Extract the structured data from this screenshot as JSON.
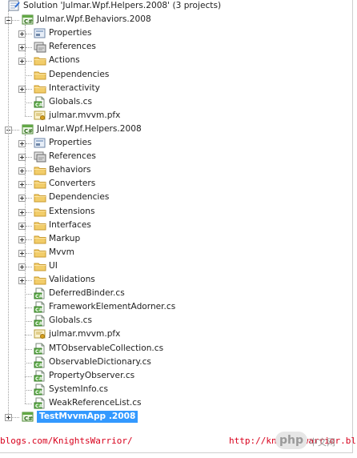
{
  "solution_explorer": {
    "solution": {
      "label": "Solution 'Julmar.Wpf.Helpers.2008' (3 projects)",
      "icon": "solution-icon"
    },
    "projects": [
      {
        "label": "Julmar.Wpf.Behaviors.2008",
        "icon": "csharp-project-icon",
        "expanded": true,
        "items": [
          {
            "label": "Properties",
            "icon": "properties-icon",
            "expandable": true
          },
          {
            "label": "References",
            "icon": "references-icon",
            "expandable": true
          },
          {
            "label": "Actions",
            "icon": "folder-icon",
            "expandable": true
          },
          {
            "label": "Dependencies",
            "icon": "folder-icon",
            "expandable": false
          },
          {
            "label": "Interactivity",
            "icon": "folder-icon",
            "expandable": true
          },
          {
            "label": "Globals.cs",
            "icon": "cs-file-icon",
            "expandable": false
          },
          {
            "label": "julmar.mvvm.pfx",
            "icon": "certificate-icon",
            "expandable": false
          }
        ]
      },
      {
        "label": "Julmar.Wpf.Helpers.2008",
        "icon": "csharp-project-icon",
        "expanded": true,
        "items": [
          {
            "label": "Properties",
            "icon": "properties-icon",
            "expandable": true
          },
          {
            "label": "References",
            "icon": "references-icon",
            "expandable": true
          },
          {
            "label": "Behaviors",
            "icon": "folder-icon",
            "expandable": true
          },
          {
            "label": "Converters",
            "icon": "folder-icon",
            "expandable": true
          },
          {
            "label": "Dependencies",
            "icon": "folder-icon",
            "expandable": true
          },
          {
            "label": "Extensions",
            "icon": "folder-icon",
            "expandable": true
          },
          {
            "label": "Interfaces",
            "icon": "folder-icon",
            "expandable": true
          },
          {
            "label": "Markup",
            "icon": "folder-icon",
            "expandable": true
          },
          {
            "label": "Mvvm",
            "icon": "folder-icon",
            "expandable": true
          },
          {
            "label": "UI",
            "icon": "folder-icon",
            "expandable": true
          },
          {
            "label": "Validations",
            "icon": "folder-icon",
            "expandable": true
          },
          {
            "label": "DeferredBinder.cs",
            "icon": "cs-file-icon",
            "expandable": false
          },
          {
            "label": "FrameworkElementAdorner.cs",
            "icon": "cs-file-icon",
            "expandable": false
          },
          {
            "label": "Globals.cs",
            "icon": "cs-file-icon",
            "expandable": false
          },
          {
            "label": "julmar.mvvm.pfx",
            "icon": "certificate-icon",
            "expandable": false
          },
          {
            "label": "MTObservableCollection.cs",
            "icon": "cs-file-icon",
            "expandable": false
          },
          {
            "label": "ObservableDictionary.cs",
            "icon": "cs-file-icon",
            "expandable": false
          },
          {
            "label": "PropertyObserver.cs",
            "icon": "cs-file-icon",
            "expandable": false
          },
          {
            "label": "SystemInfo.cs",
            "icon": "cs-file-icon",
            "expandable": false
          },
          {
            "label": "WeakReferenceList.cs",
            "icon": "cs-file-icon",
            "expandable": false
          }
        ]
      },
      {
        "label": "TestMvvmApp .2008",
        "icon": "csharp-project-icon",
        "expanded": false,
        "selected": true,
        "items": []
      }
    ]
  },
  "footer": {
    "left_url": "blogs.com/KnightsWarrior/",
    "right_url": "http://knightswarrior.bl",
    "watermark": "php",
    "watermark_suffix": "中文网"
  },
  "colors": {
    "selection": "#3399ff",
    "folder": "#f2cd6a",
    "footer_text": "#d8001c",
    "tree_lines": "#a0a0a0"
  }
}
